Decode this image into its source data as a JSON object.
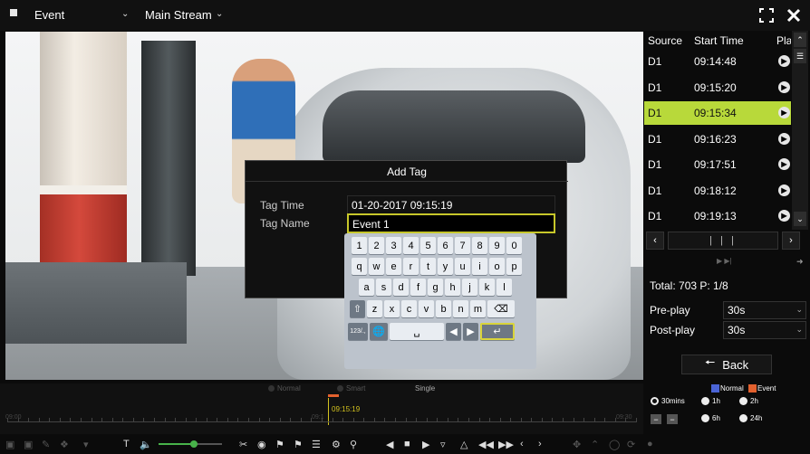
{
  "topbar": {
    "mode_label": "Event",
    "stream_label": "Main Stream",
    "fullscreen_icon": "fullscreen-icon",
    "close_icon": "close-icon"
  },
  "dialog": {
    "title": "Add Tag",
    "tag_time_label": "Tag Time",
    "tag_time_value": "01-20-2017 09:15:19",
    "tag_name_label": "Tag Name",
    "tag_name_value": "Event 1"
  },
  "keyboard": {
    "row1": [
      "1",
      "2",
      "3",
      "4",
      "5",
      "6",
      "7",
      "8",
      "9",
      "0"
    ],
    "row2": [
      "q",
      "w",
      "e",
      "r",
      "t",
      "y",
      "u",
      "i",
      "o",
      "p"
    ],
    "row3": [
      "a",
      "s",
      "d",
      "f",
      "g",
      "h",
      "j",
      "k",
      "l"
    ],
    "row4": [
      "z",
      "x",
      "c",
      "v",
      "b",
      "n",
      "m"
    ],
    "numsym_label": "123/.,"
  },
  "events_panel": {
    "col_source": "Source",
    "col_start": "Start Time",
    "col_play": "Play",
    "rows": [
      {
        "source": "D1",
        "time": "09:14:48",
        "selected": false
      },
      {
        "source": "D1",
        "time": "09:15:20",
        "selected": false
      },
      {
        "source": "D1",
        "time": "09:15:34",
        "selected": true
      },
      {
        "source": "D1",
        "time": "09:16:23",
        "selected": false
      },
      {
        "source": "D1",
        "time": "09:17:51",
        "selected": false
      },
      {
        "source": "D1",
        "time": "09:18:12",
        "selected": false
      },
      {
        "source": "D1",
        "time": "09:19:13",
        "selected": false
      }
    ],
    "total_text": "Total: 703  P: 1/8",
    "preplay_label": "Pre-play",
    "preplay_value": "30s",
    "postplay_label": "Post-play",
    "postplay_value": "30s",
    "back_label": "Back"
  },
  "timeline": {
    "mode_normal": "Normal",
    "mode_smart": "Smart",
    "mode_single": "Single",
    "start_label": "09:00",
    "mid_label": "09:1",
    "end_label": "09:30",
    "cursor_time": "09:15:19"
  },
  "legend": {
    "normal_label": "Normal",
    "event_label": "Event",
    "normal_color": "#4a64d6",
    "event_color": "#e3612e",
    "r30": "30mins",
    "r1h": "1h",
    "r2h": "2h",
    "r6h": "6h",
    "r24h": "24h",
    "selected_range": "30mins"
  },
  "volume": {
    "level_fraction": 0.55
  },
  "accent_color": "#b8d93a"
}
